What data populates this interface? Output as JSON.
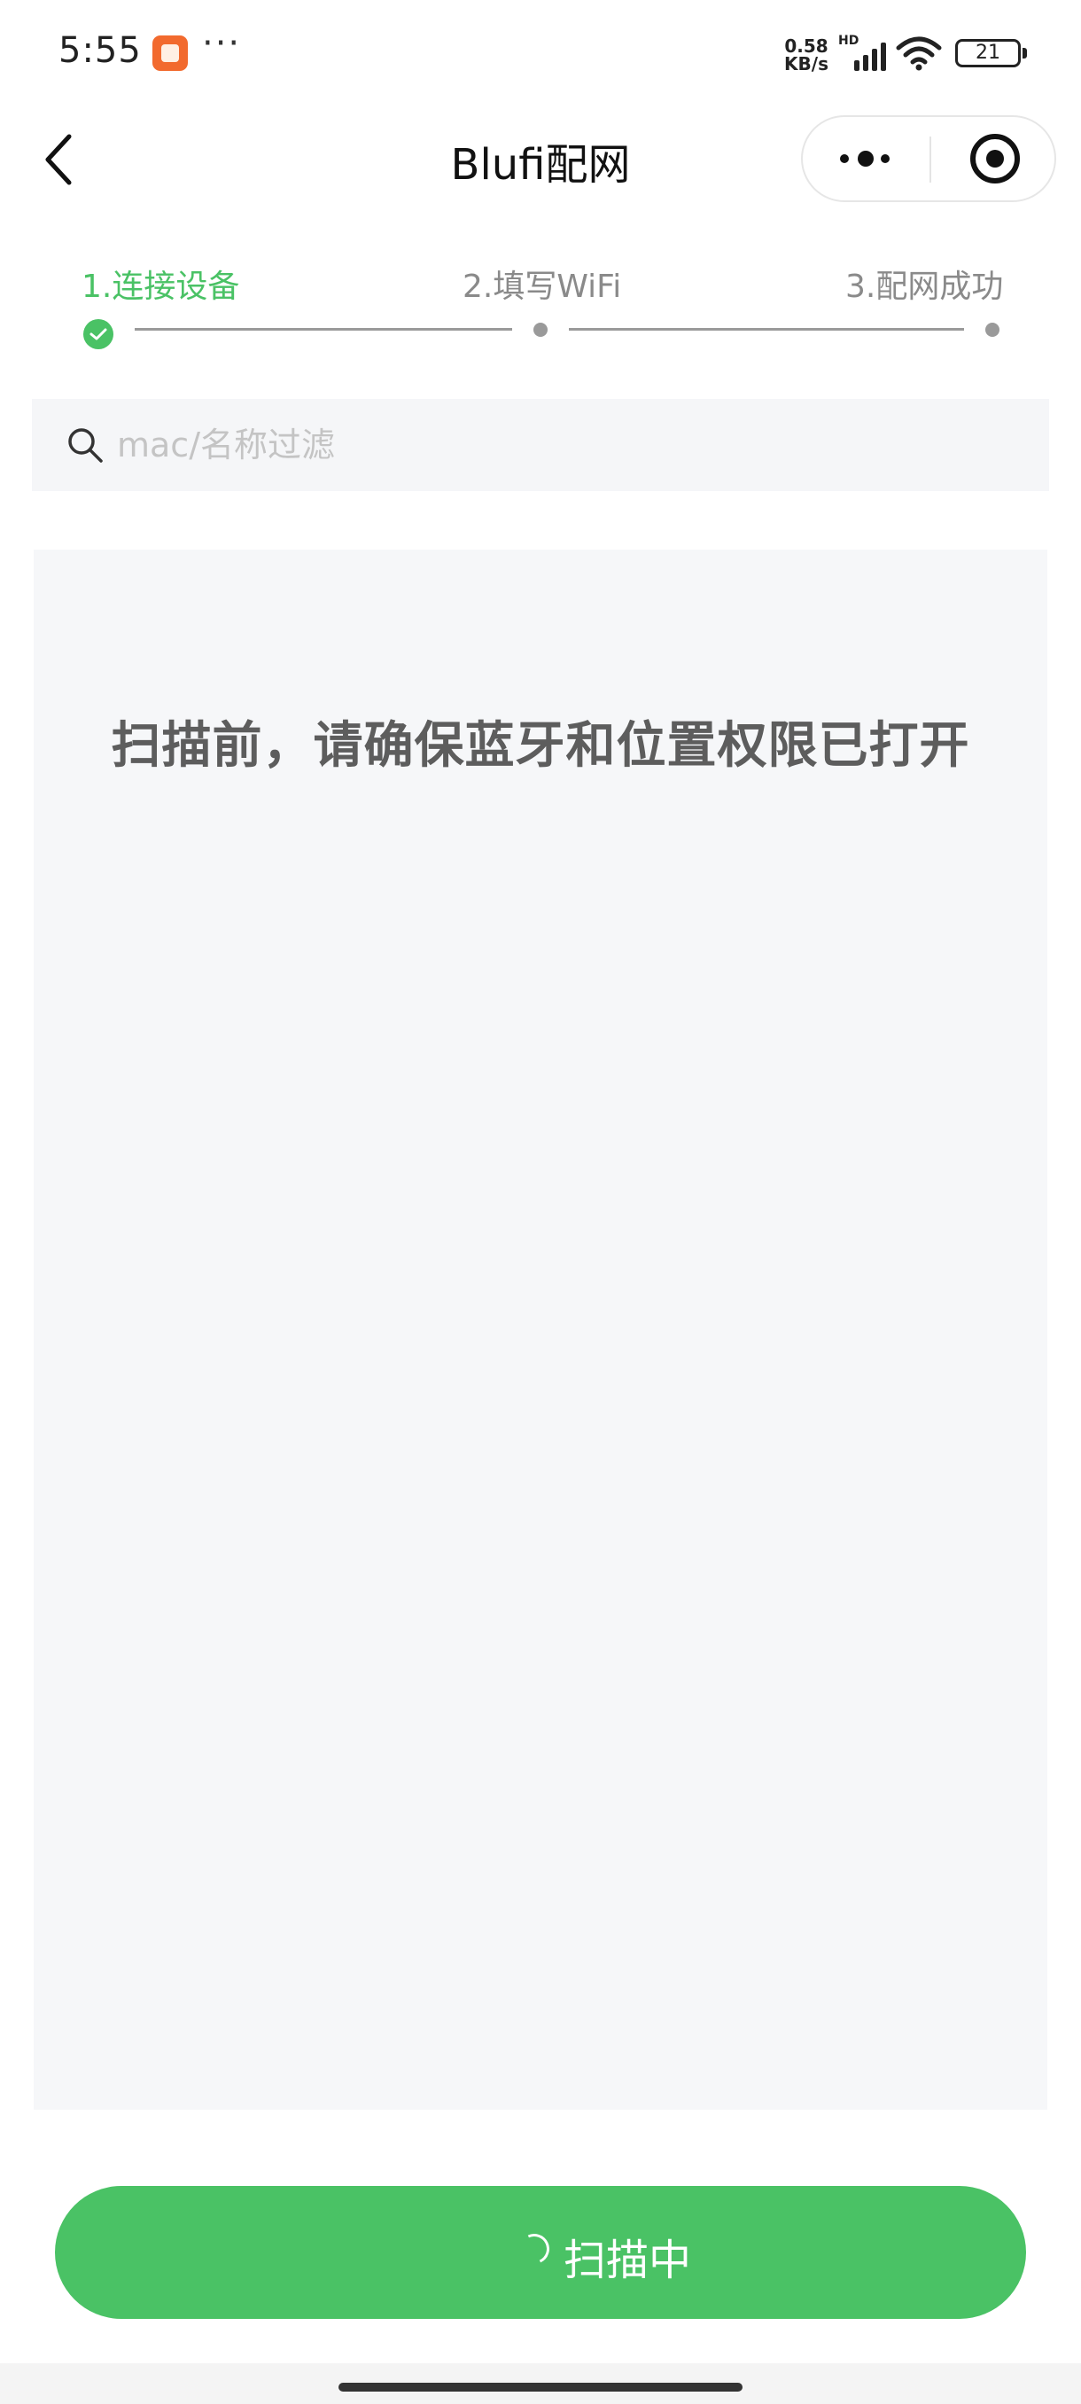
{
  "status_bar": {
    "time": "5:55",
    "more_indicator": "···",
    "net_speed_value": "0.58",
    "net_speed_unit": "KB/s",
    "network_label": "HD",
    "battery_level": "21"
  },
  "nav": {
    "title": "Blufi配网",
    "back_icon": "chevron-left-icon",
    "more_icon": "more-dots-icon",
    "close_icon": "target-circle-icon"
  },
  "steps": [
    {
      "label": "1.连接设备",
      "state": "done"
    },
    {
      "label": "2.填写WiFi",
      "state": "pending"
    },
    {
      "label": "3.配网成功",
      "state": "pending"
    }
  ],
  "search": {
    "placeholder": "mac/名称过滤",
    "value": ""
  },
  "device_list": {
    "empty_tip": "扫描前，请确保蓝牙和位置权限已打开"
  },
  "scan_button": {
    "label": "扫描中",
    "loading": true
  },
  "colors": {
    "accent": "#4ac265",
    "muted_text": "#8a8a8a",
    "panel_bg": "#f6f7f9",
    "tip_text": "#5d5d5d"
  }
}
